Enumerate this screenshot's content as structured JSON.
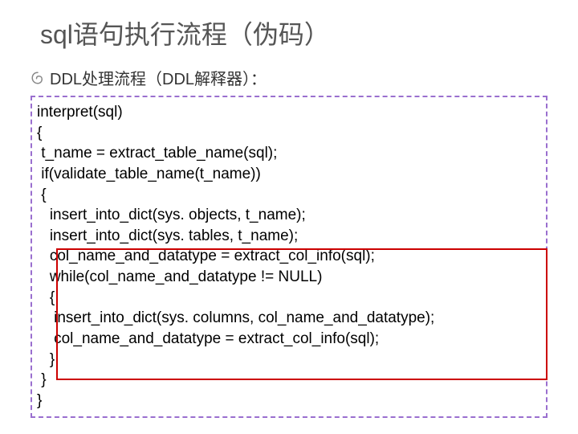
{
  "title": "sql语句执行流程（伪码）",
  "subtitle": "DDL处理流程（DDL解释器）：",
  "code": {
    "l1": "interpret(sql)",
    "l2": "{",
    "l3": " t_name = extract_table_name(sql);",
    "l4": " if(validate_table_name(t_name))",
    "l5": " {",
    "l6": "   insert_into_dict(sys. objects, t_name);",
    "l7": "   insert_into_dict(sys. tables, t_name);",
    "l8": "   col_name_and_datatype = extract_col_info(sql);",
    "l9": "   while(col_name_and_datatype != NULL)",
    "l10": "   {",
    "l11": "    insert_into_dict(sys. columns, col_name_and_datatype);",
    "l12": "    col_name_and_datatype = extract_col_info(sql);",
    "l13": "   }",
    "l14": " }",
    "l15": "}"
  }
}
